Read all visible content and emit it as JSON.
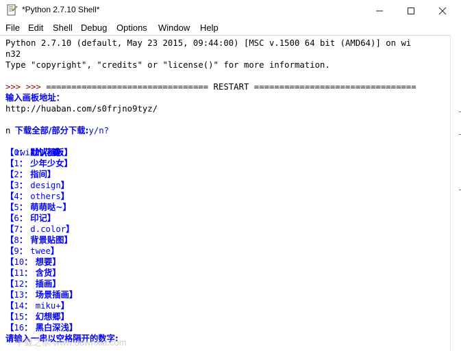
{
  "window": {
    "title": "*Python 2.7.10 Shell*"
  },
  "menu": [
    "File",
    "Edit",
    "Shell",
    "Debug",
    "Options",
    "Window",
    "Help"
  ],
  "shell": {
    "banner1": "Python 2.7.10 (default, May 23 2015, 09:44:00) [MSC v.1500 64 bit (AMD64)] on wi",
    "banner2": "n32",
    "banner3": "Type \"copyright\", \"credits\" or \"license()\" for more information.",
    "restart_prompt": ">>> ",
    "restart_line": "================================ RESTART ================================",
    "prompt2": ">>> ",
    "ask_url": "输入画板地址：",
    "url_input": "http://huaban.com/s0frjno9tyz/",
    "ask_all_prefix": "下载全部/部分下载:",
    "ask_all_suffix": "y/n?",
    "answer": "n",
    "boards_owner": "zwik",
    "boards_title": "的花瓣:",
    "boards": [
      {
        "idx": "0",
        "name": "默认画板",
        "cjk": true
      },
      {
        "idx": "1",
        "name": "少年少女",
        "cjk": true
      },
      {
        "idx": "2",
        "name": "指间",
        "cjk": true
      },
      {
        "idx": "3",
        "name": "design",
        "cjk": false
      },
      {
        "idx": "4",
        "name": "others",
        "cjk": false
      },
      {
        "idx": "5",
        "name": "萌萌哒~",
        "cjk": true
      },
      {
        "idx": "6",
        "name": "印记",
        "cjk": true
      },
      {
        "idx": "7",
        "name": "d.color",
        "cjk": false
      },
      {
        "idx": "8",
        "name": "背景贴图",
        "cjk": true
      },
      {
        "idx": "9",
        "name": "twee",
        "cjk": false
      },
      {
        "idx": "10",
        "name": "想要",
        "cjk": true
      },
      {
        "idx": "11",
        "name": "含货",
        "cjk": true
      },
      {
        "idx": "12",
        "name": "插画",
        "cjk": true
      },
      {
        "idx": "13",
        "name": "场景插画",
        "cjk": true
      },
      {
        "idx": "14",
        "name": "miku+",
        "cjk": false
      },
      {
        "idx": "15",
        "name": "幻想郷",
        "cjk": true
      },
      {
        "idx": "16",
        "name": "黑白深浅",
        "cjk": true
      }
    ],
    "final_prompt": "请输入一串以空格隔开的数字:"
  },
  "watermark": "下载之家 www.downxia.com",
  "colors": {
    "stdout": "#0000ff",
    "prompt": "#8b0000",
    "text": "#000000"
  }
}
